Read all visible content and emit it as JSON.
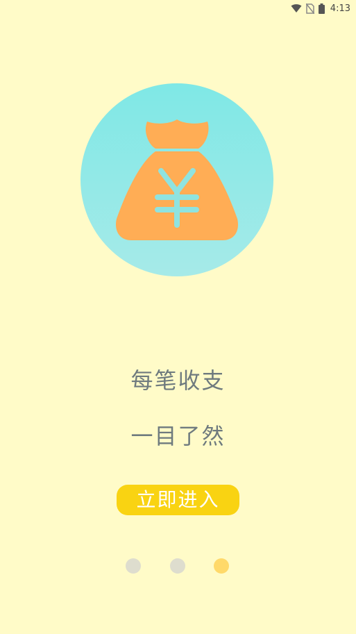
{
  "status_bar": {
    "time": "4:13",
    "icons": [
      "wifi-icon",
      "no-sim-icon",
      "battery-icon"
    ]
  },
  "hero": {
    "icon": "money-bag-yen-icon",
    "symbol": "¥"
  },
  "tagline": {
    "line1": "每笔收支",
    "line2": "一目了然"
  },
  "enter_button": {
    "label": "立即进入"
  },
  "pager": {
    "count": 3,
    "active_index": 2
  },
  "colors": {
    "background": "#FFFBC8",
    "circle": "#85E6E4",
    "bag": "#FFAD55",
    "accent": "#F9D312",
    "text": "#6E7A7E"
  }
}
